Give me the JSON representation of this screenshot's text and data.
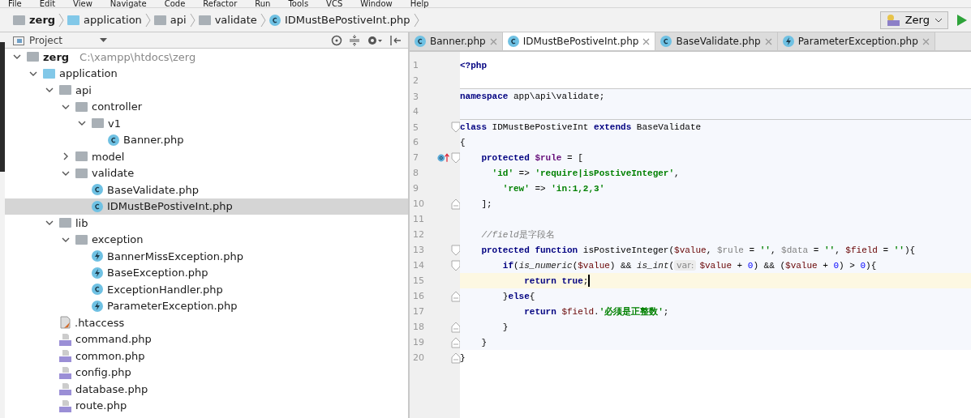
{
  "menu": [
    "File",
    "Edit",
    "View",
    "Navigate",
    "Code",
    "Refactor",
    "Run",
    "Tools",
    "VCS",
    "Window",
    "Help"
  ],
  "breadcrumbs": [
    {
      "label": "zerg",
      "kind": "root"
    },
    {
      "label": "application",
      "kind": "source-folder"
    },
    {
      "label": "api",
      "kind": "folder"
    },
    {
      "label": "validate",
      "kind": "folder"
    },
    {
      "label": "IDMustBePostiveInt.php",
      "kind": "class"
    }
  ],
  "run_config": {
    "label": "Zerg"
  },
  "project_panel": {
    "title": "Project",
    "tree": [
      {
        "label": "zerg",
        "path": "C:\\xampp\\htdocs\\zerg",
        "kind": "root",
        "expanded": true,
        "selected": false,
        "children": [
          {
            "label": "application",
            "kind": "source-folder",
            "expanded": true,
            "selected": false,
            "children": [
              {
                "label": "api",
                "kind": "folder",
                "expanded": true,
                "selected": false,
                "children": [
                  {
                    "label": "controller",
                    "kind": "folder",
                    "expanded": true,
                    "selected": false,
                    "children": [
                      {
                        "label": "v1",
                        "kind": "folder",
                        "expanded": true,
                        "selected": false,
                        "children": [
                          {
                            "label": "Banner.php",
                            "kind": "class",
                            "selected": false
                          }
                        ]
                      }
                    ]
                  },
                  {
                    "label": "model",
                    "kind": "folder",
                    "expanded": false,
                    "selected": false
                  },
                  {
                    "label": "validate",
                    "kind": "folder",
                    "expanded": true,
                    "selected": false,
                    "children": [
                      {
                        "label": "BaseValidate.php",
                        "kind": "class",
                        "selected": false
                      },
                      {
                        "label": "IDMustBePostiveInt.php",
                        "kind": "class",
                        "selected": true
                      }
                    ]
                  }
                ]
              },
              {
                "label": "lib",
                "kind": "folder",
                "expanded": true,
                "selected": false,
                "children": [
                  {
                    "label": "exception",
                    "kind": "folder",
                    "expanded": true,
                    "selected": false,
                    "children": [
                      {
                        "label": "BannerMissException.php",
                        "kind": "exception",
                        "selected": false
                      },
                      {
                        "label": "BaseException.php",
                        "kind": "exception",
                        "selected": false
                      },
                      {
                        "label": "ExceptionHandler.php",
                        "kind": "class",
                        "selected": false
                      },
                      {
                        "label": "ParameterException.php",
                        "kind": "exception",
                        "selected": false
                      }
                    ]
                  }
                ]
              },
              {
                "label": ".htaccess",
                "kind": "htaccess",
                "selected": false
              },
              {
                "label": "command.php",
                "kind": "php",
                "selected": false
              },
              {
                "label": "common.php",
                "kind": "php",
                "selected": false
              },
              {
                "label": "config.php",
                "kind": "php",
                "selected": false
              },
              {
                "label": "database.php",
                "kind": "php",
                "selected": false
              },
              {
                "label": "route.php",
                "kind": "php",
                "selected": false
              }
            ]
          }
        ]
      }
    ]
  },
  "editor_tabs": [
    {
      "label": "Banner.php",
      "kind": "class",
      "selected": false
    },
    {
      "label": "IDMustBePostiveInt.php",
      "kind": "class",
      "selected": true
    },
    {
      "label": "BaseValidate.php",
      "kind": "class",
      "selected": false
    },
    {
      "label": "ParameterException.php",
      "kind": "exception",
      "selected": false
    }
  ],
  "code": [
    {
      "number": "1",
      "tokens": [
        {
          "kind": "keyword",
          "text": "<?php"
        }
      ]
    },
    {
      "number": "2"
    },
    {
      "number": "3",
      "separator": true,
      "tokens": [
        {
          "kind": "keyword",
          "text": "namespace"
        },
        {
          "kind": "plain",
          "text": " app\\api\\validate;"
        }
      ]
    },
    {
      "number": "4"
    },
    {
      "number": "5",
      "separator": true,
      "fold_start": true,
      "tokens": [
        {
          "kind": "keyword",
          "text": "class"
        },
        {
          "kind": "plain",
          "text": " IDMustBePostiveInt "
        },
        {
          "kind": "keyword",
          "text": "extends"
        },
        {
          "kind": "plain",
          "text": " BaseValidate"
        }
      ]
    },
    {
      "number": "6",
      "tokens": [
        {
          "kind": "plain",
          "text": "{"
        }
      ]
    },
    {
      "number": "7",
      "fold_start": true,
      "implements_marker": true,
      "tokens": [
        {
          "kind": "keyword",
          "text": "    protected "
        },
        {
          "kind": "field",
          "text": "$rule"
        },
        {
          "kind": "plain",
          "text": " = ["
        }
      ]
    },
    {
      "number": "8",
      "tokens": [
        {
          "kind": "string",
          "text": "      'id'"
        },
        {
          "kind": "plain",
          "text": " => "
        },
        {
          "kind": "string",
          "text": "'require|isPostiveInteger'"
        },
        {
          "kind": "plain",
          "text": ","
        }
      ]
    },
    {
      "number": "9",
      "tokens": [
        {
          "kind": "string",
          "text": "        'rew'"
        },
        {
          "kind": "plain",
          "text": " => "
        },
        {
          "kind": "string",
          "text": "'in:1,2,3'"
        }
      ]
    },
    {
      "number": "10",
      "fold_end": true,
      "tokens": [
        {
          "kind": "plain",
          "text": "    ];"
        }
      ]
    },
    {
      "number": "11"
    },
    {
      "number": "12",
      "tokens": [
        {
          "kind": "comment",
          "text": "    //field"
        },
        {
          "kind": "comment-cjk",
          "text": "是字段名"
        }
      ]
    },
    {
      "number": "13",
      "fold_start": true,
      "tokens": [
        {
          "kind": "keyword",
          "text": "    protected function"
        },
        {
          "kind": "plain",
          "text": " isPostiveInteger("
        },
        {
          "kind": "param",
          "text": "$value"
        },
        {
          "kind": "plain",
          "text": ", "
        },
        {
          "kind": "unused",
          "text": "$rule"
        },
        {
          "kind": "plain",
          "text": " = "
        },
        {
          "kind": "string",
          "text": "''"
        },
        {
          "kind": "plain",
          "text": ", "
        },
        {
          "kind": "unused",
          "text": "$data"
        },
        {
          "kind": "plain",
          "text": " = "
        },
        {
          "kind": "string",
          "text": "''"
        },
        {
          "kind": "plain",
          "text": ", "
        },
        {
          "kind": "param",
          "text": "$field"
        },
        {
          "kind": "plain",
          "text": " = "
        },
        {
          "kind": "string",
          "text": "''"
        },
        {
          "kind": "plain",
          "text": "){"
        }
      ]
    },
    {
      "number": "14",
      "fold_start": true,
      "tokens": [
        {
          "kind": "keyword",
          "text": "        if"
        },
        {
          "kind": "plain",
          "text": "("
        },
        {
          "kind": "call",
          "text": "is_numeric"
        },
        {
          "kind": "plain",
          "text": "("
        },
        {
          "kind": "param",
          "text": "$value"
        },
        {
          "kind": "plain",
          "text": ") && "
        },
        {
          "kind": "call",
          "text": "is_int"
        },
        {
          "kind": "plain",
          "text": "("
        },
        {
          "kind": "hint",
          "text": "var:"
        },
        {
          "kind": "param",
          "text": "$value"
        },
        {
          "kind": "plain",
          "text": " + "
        },
        {
          "kind": "number",
          "text": "0"
        },
        {
          "kind": "plain",
          "text": ") && ("
        },
        {
          "kind": "param",
          "text": "$value"
        },
        {
          "kind": "plain",
          "text": " + "
        },
        {
          "kind": "number",
          "text": "0"
        },
        {
          "kind": "plain",
          "text": ") > "
        },
        {
          "kind": "number",
          "text": "0"
        },
        {
          "kind": "plain",
          "text": "){"
        }
      ]
    },
    {
      "number": "15",
      "current": true,
      "caret": true,
      "tokens": [
        {
          "kind": "keyword",
          "text": "            return true"
        },
        {
          "kind": "plain",
          "text": ";"
        }
      ]
    },
    {
      "number": "16",
      "fold_end": true,
      "tokens": [
        {
          "kind": "plain",
          "text": "        }"
        },
        {
          "kind": "keyword",
          "text": "else"
        },
        {
          "kind": "plain",
          "text": "{"
        }
      ]
    },
    {
      "number": "17",
      "tokens": [
        {
          "kind": "keyword",
          "text": "            return "
        },
        {
          "kind": "param",
          "text": "$field"
        },
        {
          "kind": "plain",
          "text": "."
        },
        {
          "kind": "string",
          "text": "'必须是正整数'"
        },
        {
          "kind": "plain",
          "text": ";"
        }
      ]
    },
    {
      "number": "18",
      "fold_end": true,
      "tokens": [
        {
          "kind": "plain",
          "text": "        }"
        }
      ]
    },
    {
      "number": "19",
      "fold_end": true,
      "tokens": [
        {
          "kind": "plain",
          "text": "    }"
        }
      ]
    },
    {
      "number": "20",
      "fold_end": true,
      "tokens": [
        {
          "kind": "plain",
          "text": "}"
        }
      ]
    }
  ]
}
